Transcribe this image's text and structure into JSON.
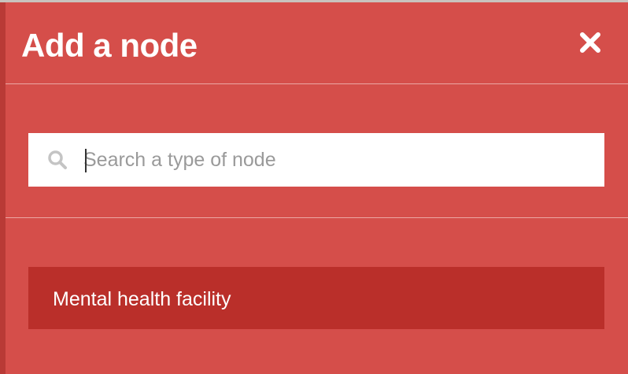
{
  "dialog": {
    "title": "Add a node",
    "close_icon": "close-icon"
  },
  "search": {
    "placeholder": "Search a type of node",
    "value": "",
    "icon": "search-icon"
  },
  "results": [
    {
      "label": "Mental health facility"
    }
  ],
  "colors": {
    "panel_background": "#d54e4a",
    "result_background": "#ba2f2a",
    "text": "#ffffff",
    "placeholder": "#9a9a9a"
  }
}
